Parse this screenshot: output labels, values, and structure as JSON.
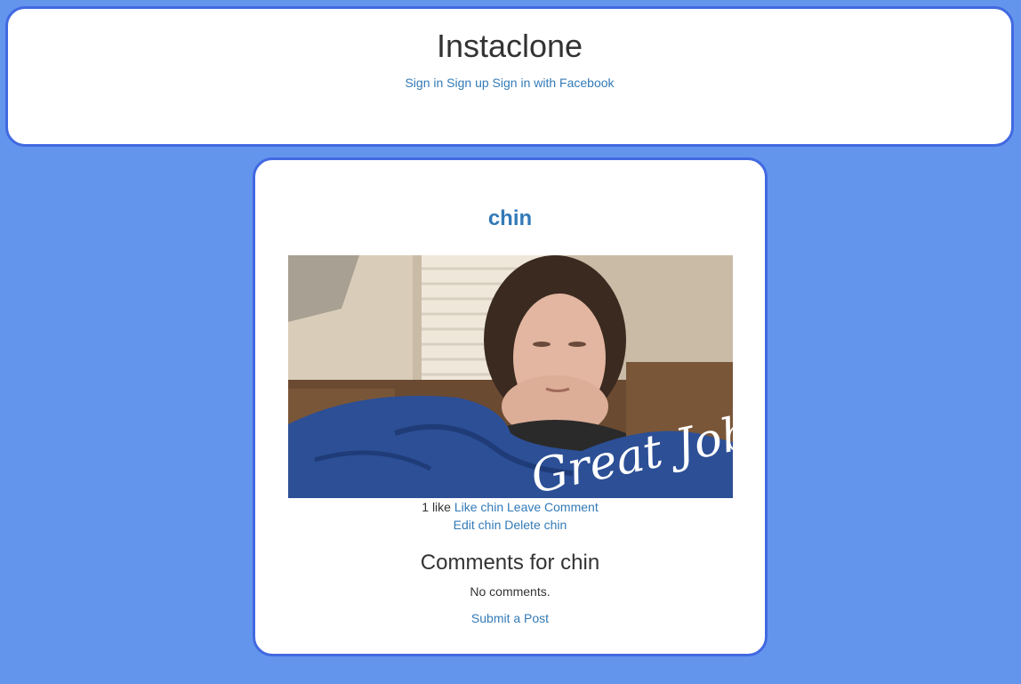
{
  "header": {
    "title": "Instaclone",
    "nav": {
      "sign_in": "Sign in",
      "sign_up": "Sign up",
      "sign_in_facebook": "Sign in with Facebook"
    }
  },
  "post": {
    "title": "chin",
    "image_caption_overlay": "Great Job!",
    "likes_text": "1 like",
    "like_link": "Like chin",
    "leave_comment_link": "Leave Comment",
    "edit_link": "Edit chin",
    "delete_link": "Delete chin"
  },
  "comments": {
    "heading": "Comments for chin",
    "empty_text": "No comments.",
    "submit_link": "Submit a Post"
  },
  "colors": {
    "background": "#6495ED",
    "card_border": "#4169E1",
    "link": "#337ab7",
    "text": "#333333"
  }
}
